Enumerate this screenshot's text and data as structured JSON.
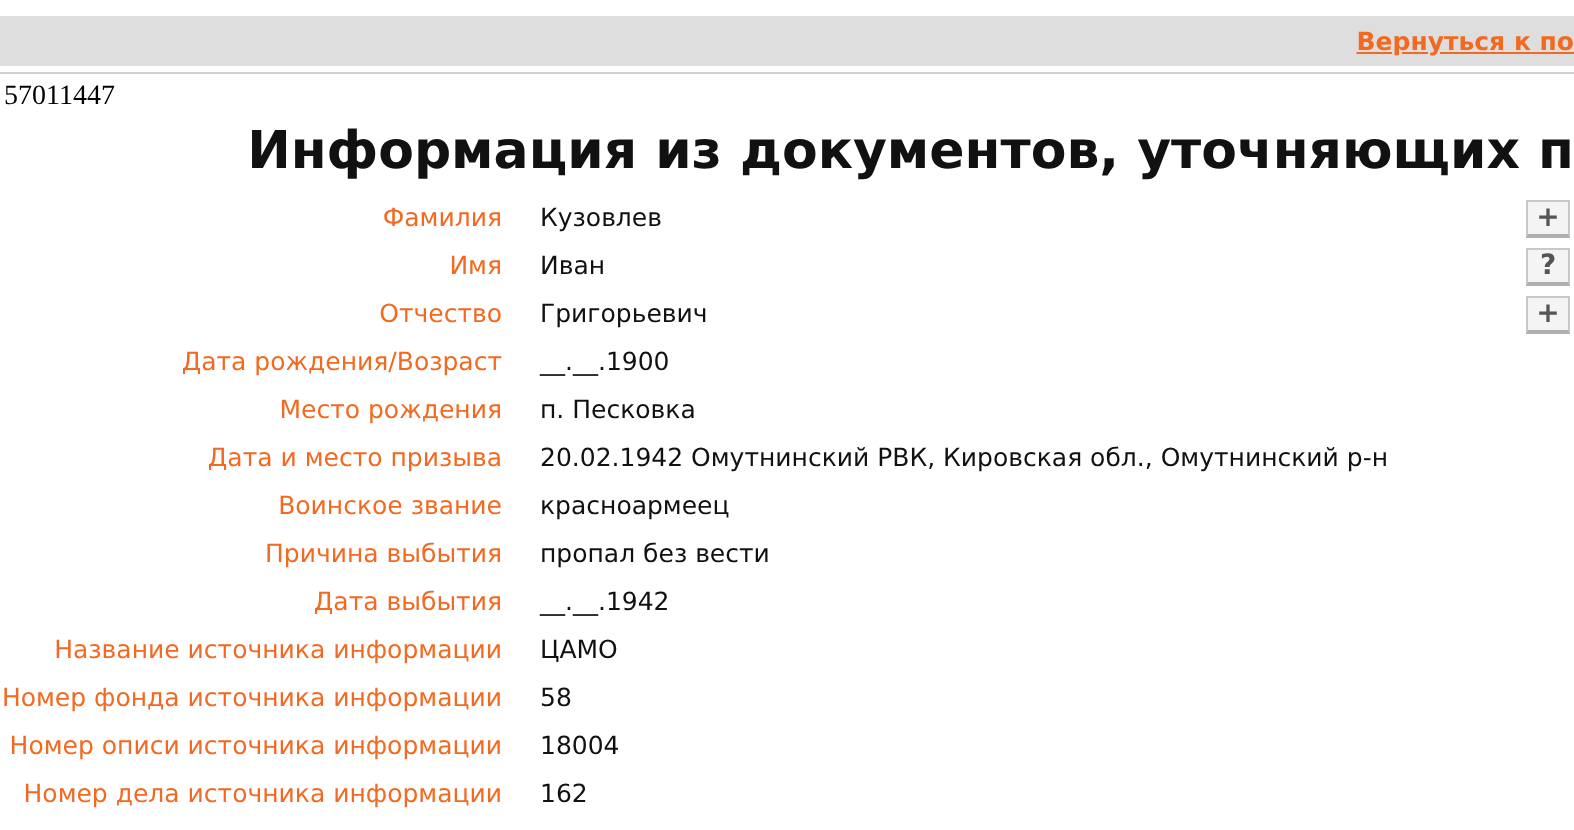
{
  "top_bar": {
    "link": "Вернуться к по"
  },
  "record_id": "57011447",
  "title": "Информация из документов, уточняющих п",
  "fields": [
    {
      "label": "Фамилия",
      "value": "Кузовлев",
      "action": "+"
    },
    {
      "label": "Имя",
      "value": "Иван",
      "action": "?"
    },
    {
      "label": "Отчество",
      "value": "Григорьевич",
      "action": "+"
    },
    {
      "label": "Дата рождения/Возраст",
      "value": "__.__.1900"
    },
    {
      "label": "Место рождения",
      "value": "п. Песковка"
    },
    {
      "label": "Дата и место призыва",
      "value": "20.02.1942 Омутнинский РВК, Кировская обл., Омутнинский р-н"
    },
    {
      "label": "Воинское звание",
      "value": "красноармеец"
    },
    {
      "label": "Причина выбытия",
      "value": "пропал без вести"
    },
    {
      "label": "Дата выбытия",
      "value": "__.__.1942"
    },
    {
      "label": "Название источника информации",
      "value": "ЦАМО"
    },
    {
      "label": "Номер фонда источника информации",
      "value": "58"
    },
    {
      "label": "Номер описи источника информации",
      "value": "18004"
    },
    {
      "label": "Номер дела источника информации",
      "value": "162"
    }
  ]
}
